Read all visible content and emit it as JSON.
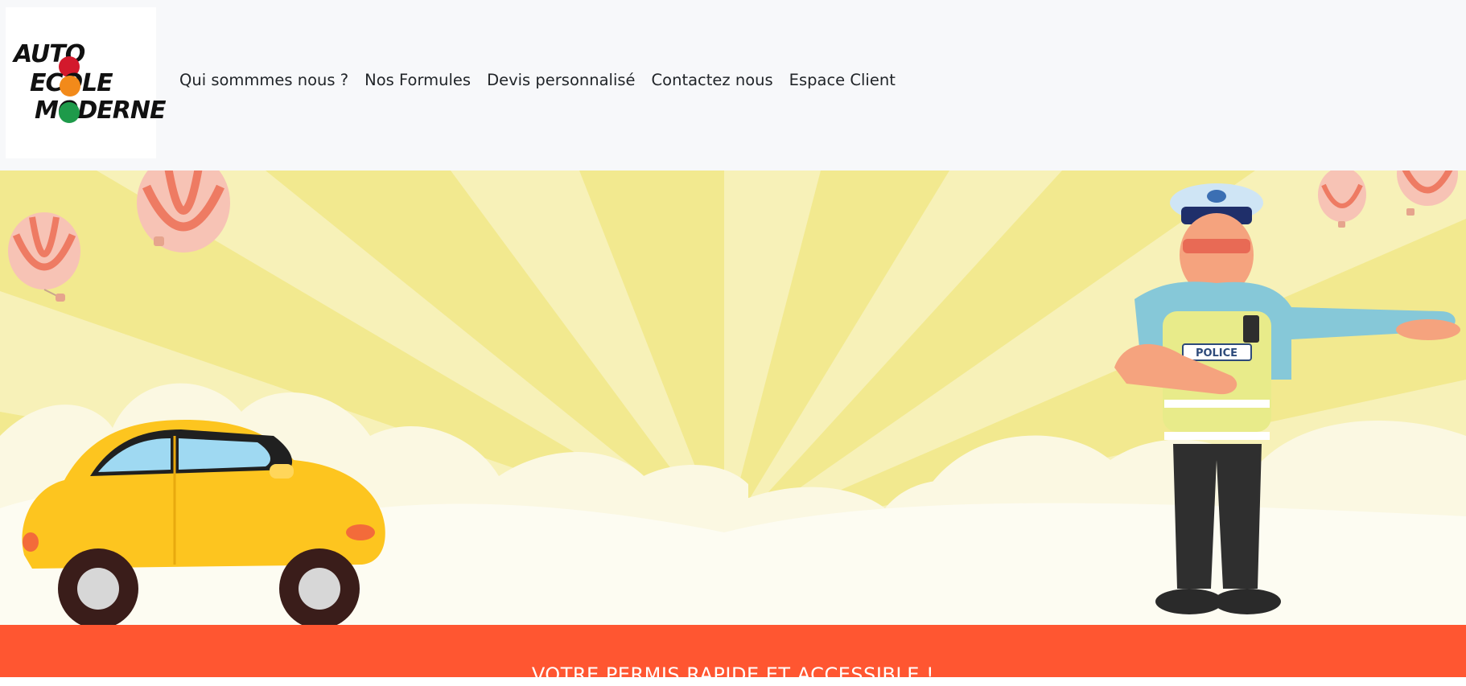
{
  "brand": {
    "logo_lines": [
      "AUTO",
      "ECOLE",
      "MODERNE"
    ],
    "dot_colors": [
      "#d3192c",
      "#f28a1a",
      "#1e9a4a"
    ]
  },
  "nav": {
    "links": [
      "Qui sommmes nous ?",
      "Nos Formules",
      "Devis personnalisé",
      "Contactez nous",
      "Espace Client"
    ]
  },
  "hero": {
    "vest_label": "POLICE",
    "icons": [
      "hot-air-balloon-icon",
      "yellow-car-icon",
      "police-officer-icon"
    ]
  },
  "banner": {
    "text": "VOTRE PERMIS RAPIDE ET ACCESSIBLE !",
    "color": "#ff5631"
  }
}
